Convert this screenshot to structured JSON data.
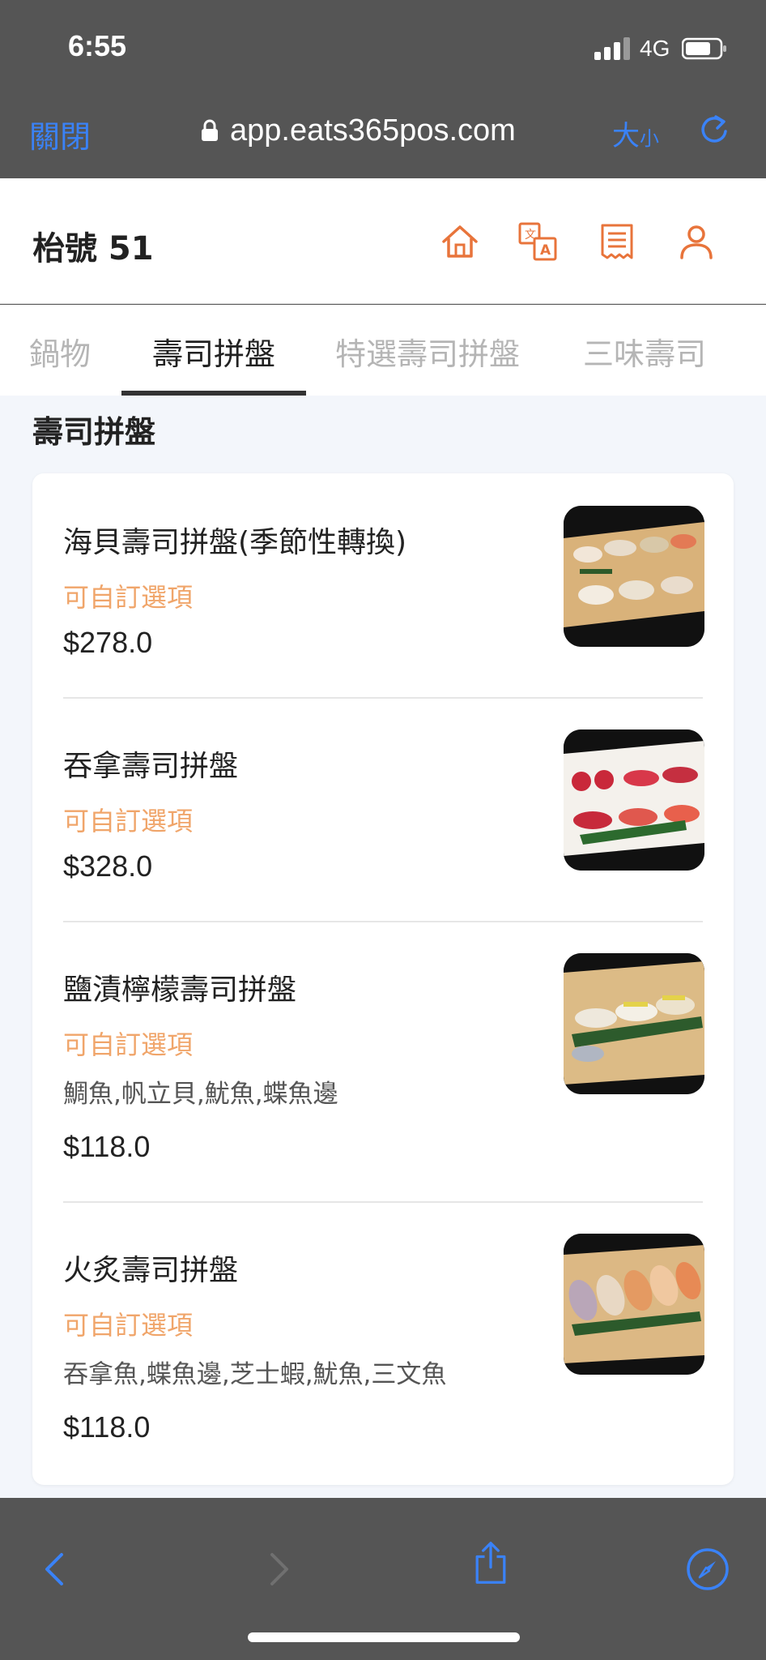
{
  "status_bar": {
    "time": "6:55",
    "network": "4G",
    "icons": [
      "signal-icon",
      "battery-icon"
    ]
  },
  "browser": {
    "close_label": "關閉",
    "url": "app.eats365pos.com",
    "size_label_big": "大",
    "size_label_small": "小",
    "icons": [
      "lock-icon",
      "reload-icon"
    ]
  },
  "header": {
    "table_title": "枱號 51",
    "icons": [
      "home-icon",
      "translate-icon",
      "receipt-icon",
      "user-icon"
    ]
  },
  "tabs": [
    {
      "label": "鍋物",
      "active": false
    },
    {
      "label": "壽司拼盤",
      "active": true
    },
    {
      "label": "特選壽司拼盤",
      "active": false
    },
    {
      "label": "三味壽司",
      "active": false
    }
  ],
  "section": {
    "title": "壽司拼盤"
  },
  "items": [
    {
      "name": "海貝壽司拼盤(季節性轉換)",
      "option": "可自訂選項",
      "desc": "",
      "price": "$278.0"
    },
    {
      "name": "吞拿壽司拼盤",
      "option": "可自訂選項",
      "desc": "",
      "price": "$328.0"
    },
    {
      "name": "鹽漬檸檬壽司拼盤",
      "option": "可自訂選項",
      "desc": "鯛魚,帆立貝,魷魚,蝶魚邊",
      "price": "$118.0"
    },
    {
      "name": "火炙壽司拼盤",
      "option": "可自訂選項",
      "desc": "吞拿魚,蝶魚邊,芝士蝦,魷魚,三文魚",
      "price": "$118.0"
    }
  ],
  "bottom_bar": {
    "icons": [
      "back-icon",
      "forward-icon",
      "share-icon",
      "compass-icon"
    ]
  },
  "colors": {
    "accent": "#e8743b",
    "link": "#3a82f7",
    "option": "#f0a56a",
    "chrome": "#555555",
    "content_bg": "#f3f6fb"
  }
}
